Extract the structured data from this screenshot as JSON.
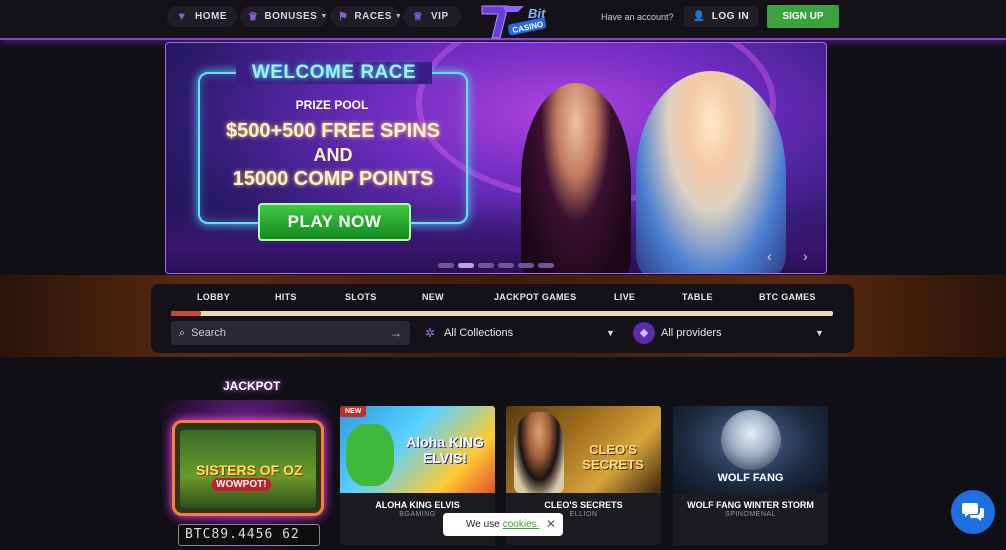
{
  "nav": {
    "home": "HOME",
    "bonuses": "BONUSES",
    "races": "RACES",
    "vip": "VIP",
    "logo_text": "7BIT CASINO",
    "account_question": "Have an account?",
    "login": "LOG IN",
    "signup": "SIGN UP"
  },
  "hero": {
    "title": "WELCOME RACE",
    "subtitle": "PRIZE POOL",
    "line1": "$500+500 FREE SPINS",
    "line2": "AND",
    "line3": "15000 COMP POINTS",
    "cta": "PLAY NOW",
    "slides": 6,
    "active_slide": 2
  },
  "tabs": [
    "LOBBY",
    "HITS",
    "SLOTS",
    "NEW",
    "JACKPOT GAMES",
    "LIVE",
    "TABLE",
    "BTC GAMES"
  ],
  "active_tab": "LOBBY",
  "search": {
    "placeholder": "Search"
  },
  "collections": {
    "value": "All Collections"
  },
  "providers": {
    "value": "All providers"
  },
  "jackpot": {
    "label": "JACKPOT",
    "game_line1": "SISTERS OF OZ",
    "game_line2": "WOWPOT!",
    "amount": "BTC89.4456 62"
  },
  "games": [
    {
      "name": "ALOHA KING ELVIS",
      "provider": "BGAMING",
      "badge": "NEW",
      "thumb_text": "Aloha KING ELVIS!"
    },
    {
      "name": "CLEO'S SECRETS",
      "provider": "ELLION",
      "badge": "",
      "thumb_text": "CLEO'S SECRETS"
    },
    {
      "name": "WOLF FANG WINTER STORM",
      "provider": "SPINOMENAL",
      "badge": "",
      "thumb_text": "WOLF FANG"
    }
  ],
  "cookie": {
    "text": "We use",
    "link": "cookies."
  },
  "colors": {
    "accent": "#8b3fd1",
    "signup": "#3aa33d",
    "chat": "#1e6fe0"
  }
}
